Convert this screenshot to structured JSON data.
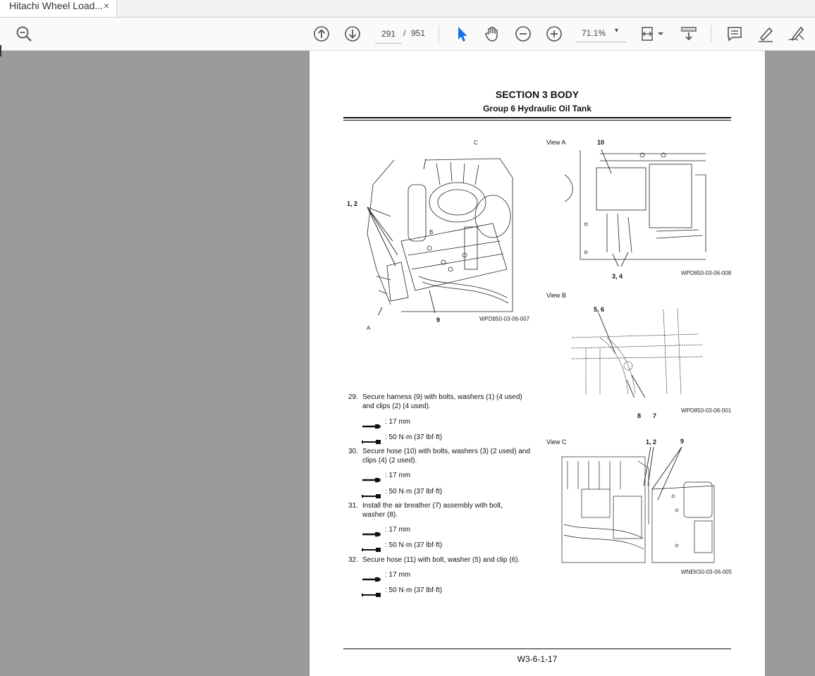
{
  "tab": {
    "title": "Hitachi Wheel Load...",
    "close": "×"
  },
  "toolbar": {
    "current_page": "291",
    "separator": "/",
    "total_pages": "951",
    "zoom": "71.1%",
    "zoom_caret": "▾"
  },
  "document": {
    "section_title": "SECTION 3 BODY",
    "group_title": "Group 6 Hydraulic Oil Tank",
    "figures": {
      "main": {
        "caption": "WPD850-03-06-007",
        "labels": {
          "c": "C",
          "b": "B",
          "a": "A",
          "l12": "1, 2",
          "l9": "9"
        }
      },
      "view_a": {
        "title": "View A",
        "caption": "WPD850-03-06-008",
        "labels": {
          "l10": "10",
          "l34": "3, 4"
        }
      },
      "view_b": {
        "title": "View B",
        "caption": "WPD850-03-06-001",
        "labels": {
          "l56": "5, 6",
          "l8": "8",
          "l7": "7"
        }
      },
      "view_c": {
        "title": "View C",
        "caption": "WNEK50-03-06-005",
        "labels": {
          "l12": "1, 2",
          "l9": "9"
        }
      }
    },
    "steps": [
      {
        "num": "29.",
        "line1": "Secure harness (9) with bolts, washers (1) (4 used)",
        "line2": "and clips (2) (4 used).",
        "wrench": ": 17 mm",
        "torque": ": 50 N·m (37 lbf·ft)"
      },
      {
        "num": "30.",
        "line1": "Secure hose (10) with bolts, washers (3) (2 used) and",
        "line2": "clips (4) (2 used).",
        "wrench": ": 17 mm",
        "torque": ": 50 N·m (37 lbf·ft)"
      },
      {
        "num": "31.",
        "line1": "Install the air breather (7) assembly with bolt,",
        "line2": "washer (8).",
        "wrench": ": 17 mm",
        "torque": ": 50 N·m (37 lbf·ft)"
      },
      {
        "num": "32.",
        "line1": "Secure hose (11) with bolt, washer (5) and clip (6).",
        "line2": "",
        "wrench": ": 17 mm",
        "torque": ": 50 N·m (37 lbf·ft)"
      }
    ],
    "footer": "W3-6-1-17"
  }
}
